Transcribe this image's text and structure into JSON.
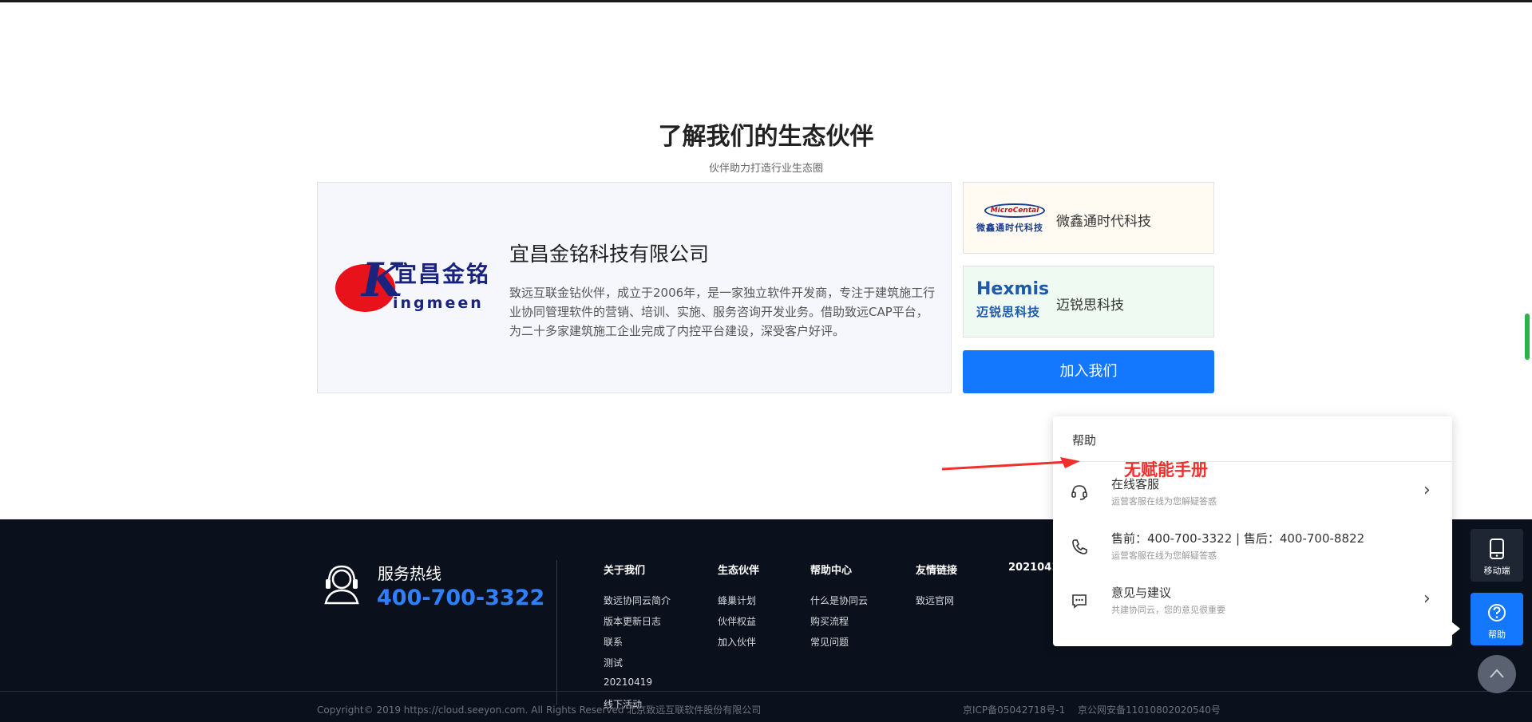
{
  "section": {
    "title": "了解我们的生态伙伴",
    "subtitle": "伙伴助力打造行业生态圈"
  },
  "featured_partner": {
    "logo_cn": "宜昌金铭",
    "logo_en": "ingmeen",
    "logo_letter": "K",
    "name": "宜昌金铭科技有限公司",
    "description": "致远互联金钻伙伴，成立于2006年，是一家独立软件开发商，专注于建筑施工行业协同管理软件的营销、培训、实施、服务咨询开发业务。借助致远CAP平台，为二十多家建筑施工企业完成了内控平台建设，深受客户好评。"
  },
  "partners": [
    {
      "name": "微鑫通时代科技",
      "logo_top": "MicroCental",
      "logo_bottom": "微鑫通时代科技"
    },
    {
      "name": "迈锐思科技",
      "logo_top": "Hexmis",
      "logo_bottom": "迈锐思科技"
    }
  ],
  "join_button": "加入我们",
  "footer": {
    "hotline_label": "服务热线",
    "hotline_number": "400-700-3322",
    "columns": [
      {
        "title": "关于我们",
        "links": [
          "致远协同云简介",
          "版本更新日志",
          "联系",
          "测试",
          "20210419",
          "线下活动"
        ]
      },
      {
        "title": "生态伙伴",
        "links": [
          "蜂巢计划",
          "伙伴权益",
          "加入伙伴"
        ]
      },
      {
        "title": "帮助中心",
        "links": [
          "什么是协同云",
          "购买流程",
          "常见问题"
        ]
      },
      {
        "title": "友情链接",
        "links": [
          "致远官网"
        ]
      },
      {
        "title": "2021041",
        "links": []
      }
    ],
    "copyright": "Copyright© 2019 https://cloud.seeyon.com. All Rights Reserved 北京致远互联软件股份有限公司",
    "icp": "京ICP备05042718号-1",
    "police": "京公网安备11010802020540号"
  },
  "help_panel": {
    "title": "帮助",
    "items": [
      {
        "title": "在线客服",
        "subtitle": "运营客服在线为您解疑答惑",
        "icon": "headset-icon"
      },
      {
        "title": "售前：400-700-3322 | 售后：400-700-8822",
        "subtitle": "运营客服在线为您解疑答惑",
        "icon": "phone-icon"
      },
      {
        "title": "意见与建议",
        "subtitle": "共建协同云，您的意见很重要",
        "icon": "feedback-icon"
      }
    ]
  },
  "annotation": {
    "text": "无赋能手册",
    "color": "#f0302c"
  },
  "floating": {
    "mobile_label": "移动端",
    "help_label": "帮助"
  },
  "colors": {
    "accent": "#1478ff",
    "footer_bg": "#0b111c",
    "hotline": "#2f80ff"
  }
}
